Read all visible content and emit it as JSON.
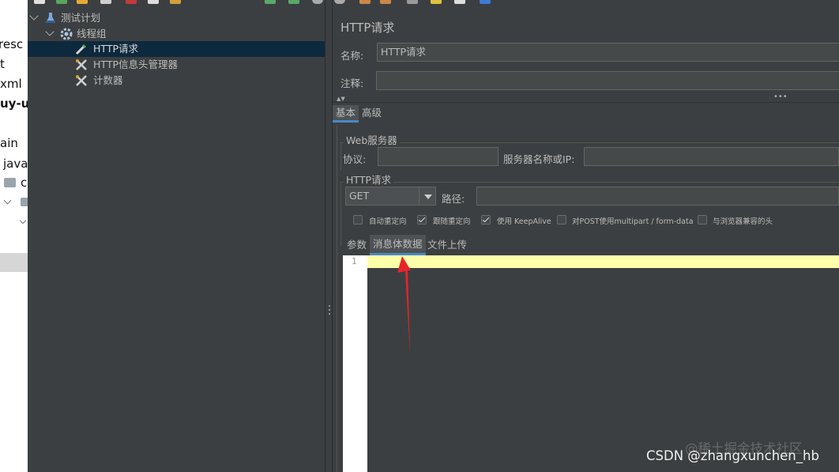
{
  "left_ide": {
    "lines": [
      "resc",
      "t",
      "xml",
      "uy-u",
      "ain",
      "java",
      "c"
    ]
  },
  "tree": {
    "items": [
      {
        "label": "测试计划",
        "icon": "flask-icon"
      },
      {
        "label": "线程组",
        "icon": "gear-icon"
      },
      {
        "label": "HTTP请求",
        "icon": "pipette-icon",
        "selected": true
      },
      {
        "label": "HTTP信息头管理器",
        "icon": "wrench-icon"
      },
      {
        "label": "计数器",
        "icon": "wrench-icon"
      }
    ]
  },
  "panel": {
    "title": "HTTP请求",
    "name_label": "名称:",
    "name_value": "HTTP请求",
    "comment_label": "注释:",
    "comment_value": "",
    "tabs": [
      "基本",
      "高级"
    ],
    "web_server_title": "Web服务器",
    "protocol_label": "协议:",
    "server_label": "服务器名称或IP:",
    "http_request_title": "HTTP请求",
    "method": "GET",
    "path_label": "路径:",
    "checkboxes": [
      {
        "label": "自动重定向",
        "checked": false
      },
      {
        "label": "跟随重定向",
        "checked": true
      },
      {
        "label": "使用 KeepAlive",
        "checked": true
      },
      {
        "label": "对POST使用multipart / form-data",
        "checked": false
      },
      {
        "label": "与浏览器兼容的头",
        "checked": false
      }
    ],
    "body_tabs": [
      "参数",
      "消息体数据",
      "文件上传"
    ],
    "line_number": "1"
  },
  "watermarks": [
    "@稀土掘金技术社区",
    "CSDN @zhangxunchen_hb"
  ],
  "colors": {
    "background": "#3c3f41",
    "selection": "#0d293e",
    "tab_underline": "#4a88c7",
    "current_line": "#ffffaa",
    "annotation_arrow": "#e8242a"
  }
}
